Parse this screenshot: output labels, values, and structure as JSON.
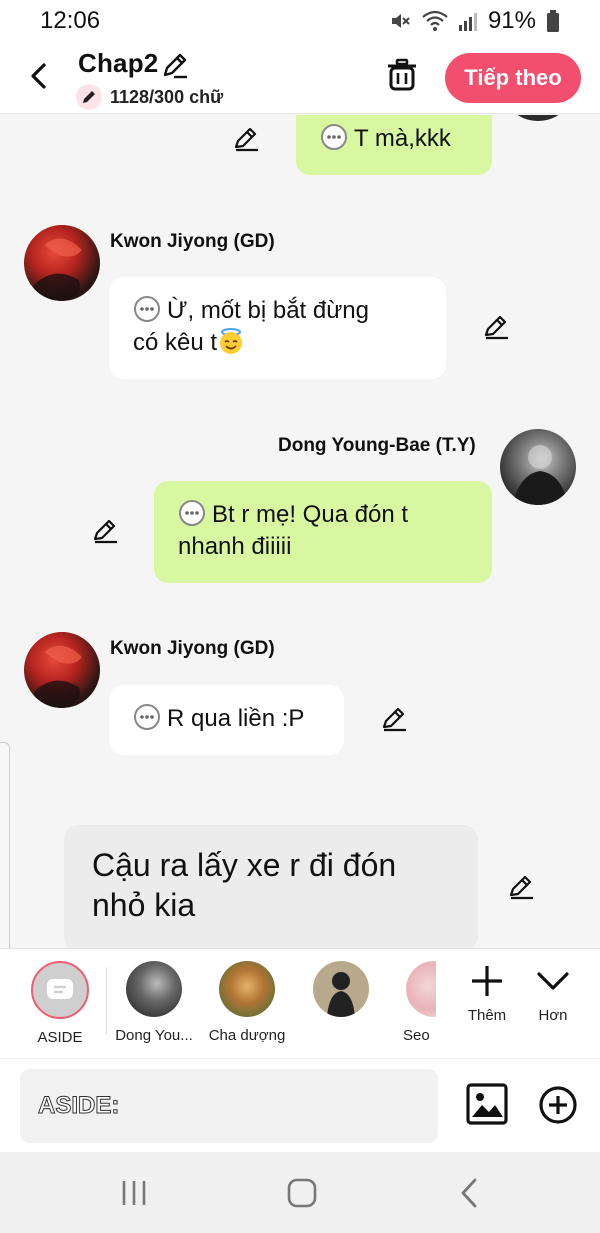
{
  "status_bar": {
    "time": "12:06",
    "battery": "91%"
  },
  "header": {
    "title": "Chap2",
    "word_count": "1128/300 chữ",
    "next_label": "Tiếp theo"
  },
  "messages": [
    {
      "text": "T mà,kkk"
    },
    {
      "sender": "Kwon Jiyong (GD)",
      "text_line1": "Ừ, mốt bị bắt đừng",
      "text_line2": "có kêu t"
    },
    {
      "sender": "Dong Young-Bae (T.Y)",
      "text_line1": "Bt r mẹ! Qua đón t",
      "text_line2": "nhanh điiiii"
    },
    {
      "sender": "Kwon Jiyong (GD)",
      "text": "R qua liền :P"
    },
    {
      "text_line1": "Cậu ra lấy xe r đi đón",
      "text_line2": "nhỏ kia"
    }
  ],
  "characters": [
    {
      "name": "ASIDE"
    },
    {
      "name": "Dong You..."
    },
    {
      "name": "Cha dượng"
    },
    {
      "name": ""
    },
    {
      "name": "Seo"
    }
  ],
  "tools": {
    "add_label": "Thêm",
    "more_label": "Hơn"
  },
  "input": {
    "placeholder": "ASIDE:"
  },
  "colors": {
    "accent": "#f24f6e",
    "my_bubble": "#d8f7a0",
    "other_bubble": "#ffffff",
    "aside_bubble": "#ececec"
  }
}
